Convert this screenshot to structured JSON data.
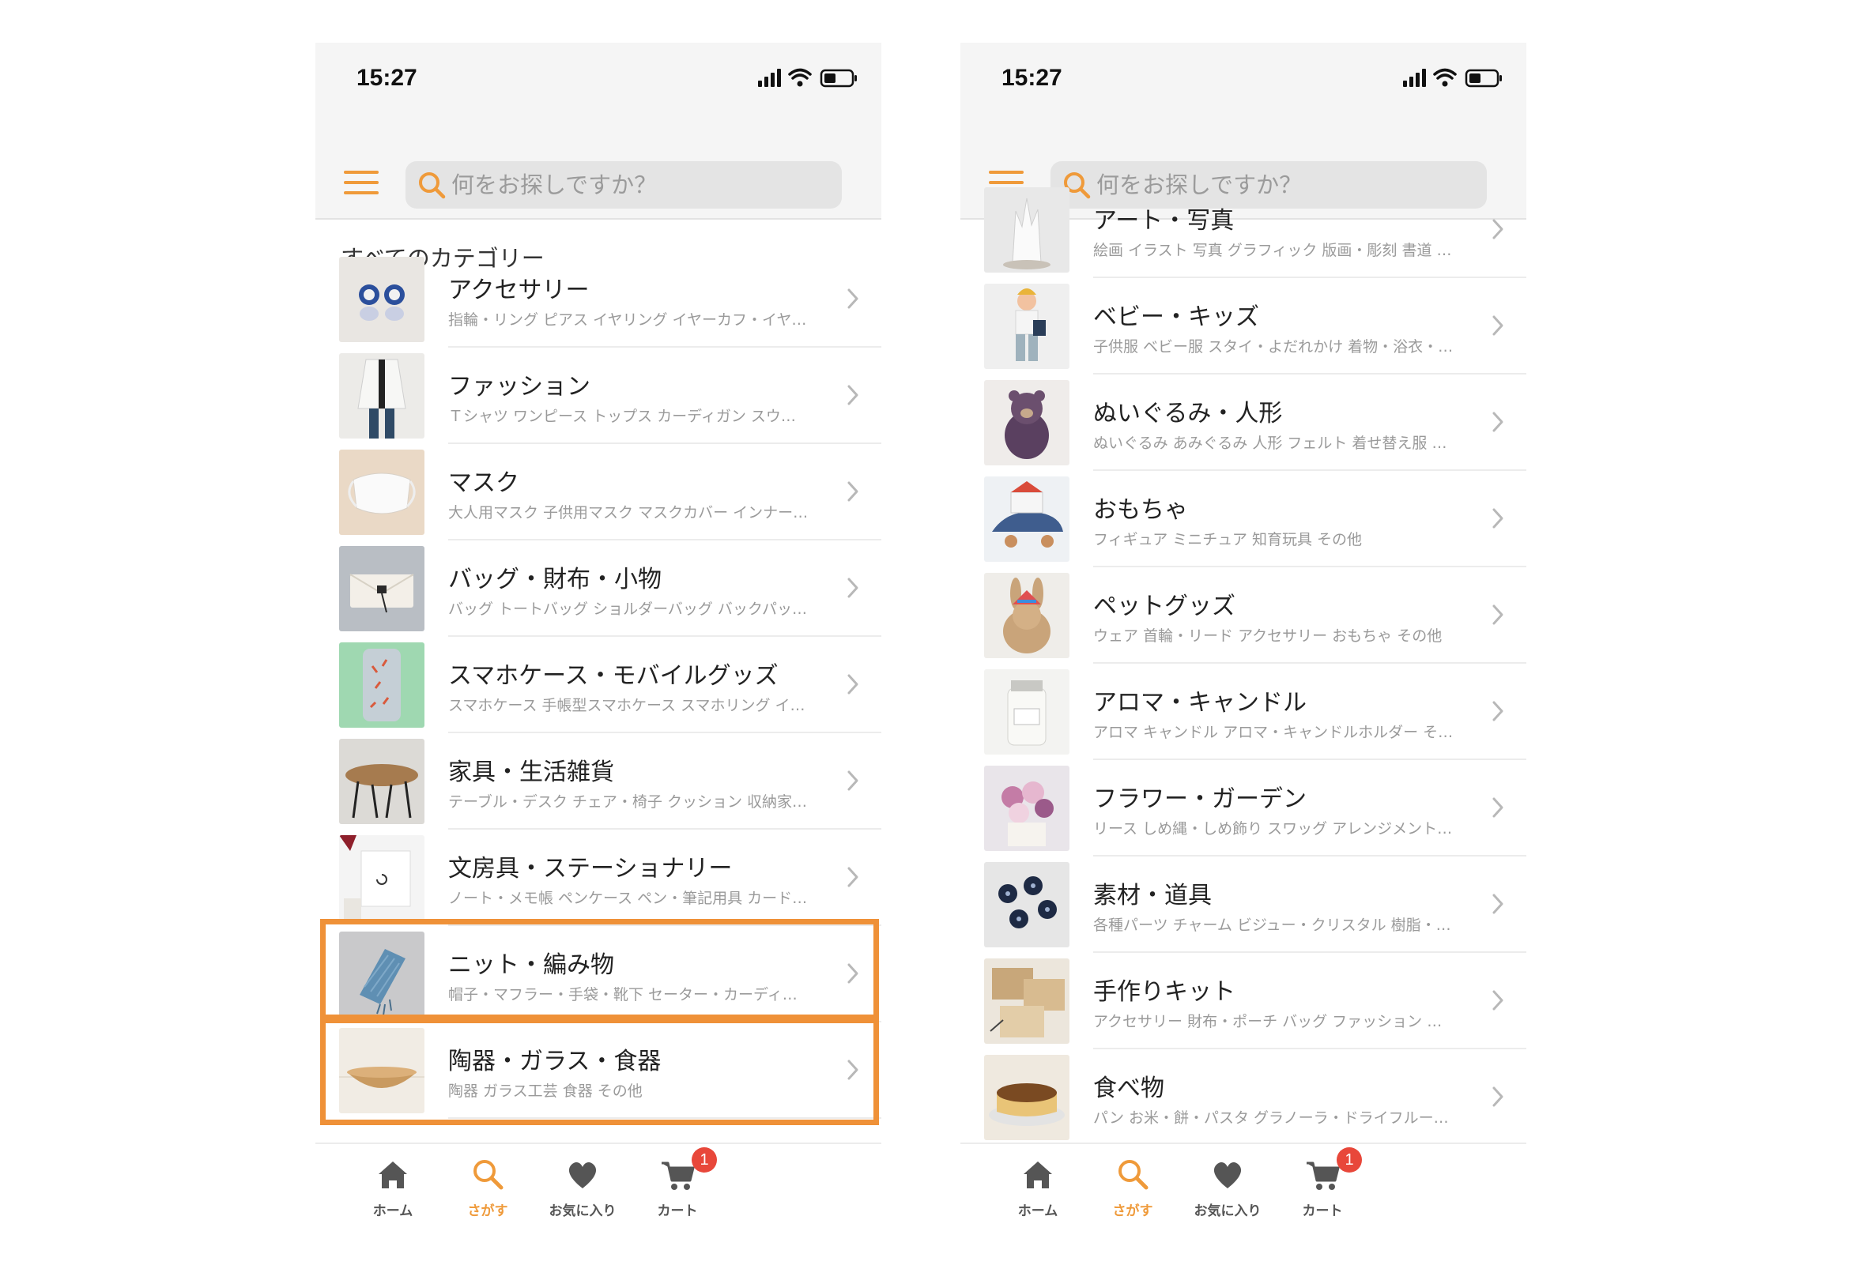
{
  "phones": [
    {
      "status_time": "15:27",
      "search_placeholder": "何をお探しですか？",
      "section_title": "すべてのカテゴリー",
      "categories": [
        {
          "name": "アクセサリー",
          "sub": "指輪・リング ピアス イヤリング イヤーカフ・イヤ…",
          "thumb": "earrings"
        },
        {
          "name": "ファッション",
          "sub": "Ｔシャツ ワンピース トップス カーディガン スウ…",
          "thumb": "coat"
        },
        {
          "name": "マスク",
          "sub": "大人用マスク 子供用マスク マスクカバー インナー…",
          "thumb": "mask"
        },
        {
          "name": "バッグ・財布・小物",
          "sub": "バッグ トートバッグ ショルダーバッグ バックパッ…",
          "thumb": "wallet"
        },
        {
          "name": "スマホケース・モバイルグッズ",
          "sub": "スマホケース 手帳型スマホケース スマホリング イ…",
          "thumb": "phonecase"
        },
        {
          "name": "家具・生活雑貨",
          "sub": "テーブル・デスク チェア・椅子 クッション 収納家…",
          "thumb": "table"
        },
        {
          "name": "文房具・ステーショナリー",
          "sub": "ノート・メモ帳 ペンケース ペン・筆記用具 カード…",
          "thumb": "stationery"
        },
        {
          "name": "ニット・編み物",
          "sub": "帽子・マフラー・手袋・靴下 セーター・カーディ…",
          "thumb": "knit"
        },
        {
          "name": "陶器・ガラス・食器",
          "sub": "陶器 ガラス工芸 食器 その他",
          "thumb": "bowl"
        }
      ],
      "tabs": [
        {
          "label": "ホーム",
          "icon": "home-icon"
        },
        {
          "label": "さがす",
          "icon": "search-icon"
        },
        {
          "label": "お気に入り",
          "icon": "heart-icon"
        },
        {
          "label": "カート",
          "icon": "cart-icon",
          "badge": "1"
        }
      ]
    },
    {
      "status_time": "15:27",
      "search_placeholder": "何をお探しですか？",
      "categories": [
        {
          "name": "アート・写真",
          "sub": "絵画 イラスト 写真 グラフィック 版画・彫刻 書道 …",
          "thumb": "art"
        },
        {
          "name": "ベビー・キッズ",
          "sub": "子供服 ベビー服 スタイ・よだれかけ 着物・浴衣・…",
          "thumb": "kid"
        },
        {
          "name": "ぬいぐるみ・人形",
          "sub": "ぬいぐるみ あみぐるみ 人形 フェルト 着せ替え服 …",
          "thumb": "bear"
        },
        {
          "name": "おもちゃ",
          "sub": "フィギュア ミニチュア 知育玩具 その他",
          "thumb": "toy"
        },
        {
          "name": "ペットグッズ",
          "sub": "ウェア 首輪・リード アクセサリー おもちゃ その他",
          "thumb": "rabbit"
        },
        {
          "name": "アロマ・キャンドル",
          "sub": "アロマ キャンドル アロマ・キャンドルホルダー そ…",
          "thumb": "candle"
        },
        {
          "name": "フラワー・ガーデン",
          "sub": "リース しめ縄・しめ飾り スワッグ アレンジメント…",
          "thumb": "flowers"
        },
        {
          "name": "素材・道具",
          "sub": "各種パーツ チャーム ビジュー・クリスタル 樹脂・…",
          "thumb": "buttons"
        },
        {
          "name": "手作りキット",
          "sub": "アクセサリー 財布・ポーチ バッグ ファッション …",
          "thumb": "kit"
        },
        {
          "name": "食べ物",
          "sub": "パン お米・餅・パスタ グラノーラ・ドライフルー…",
          "thumb": "cake"
        }
      ],
      "tabs": [
        {
          "label": "ホーム",
          "icon": "home-icon"
        },
        {
          "label": "さがす",
          "icon": "search-icon"
        },
        {
          "label": "お気に入り",
          "icon": "heart-icon"
        },
        {
          "label": "カート",
          "icon": "cart-icon",
          "badge": "1"
        }
      ]
    }
  ],
  "colors": {
    "accent": "#ef9a3a",
    "highlight": "#ef9138",
    "badge": "#e8473a",
    "subtext": "#9a9a9a"
  },
  "active_tab": "さがす"
}
